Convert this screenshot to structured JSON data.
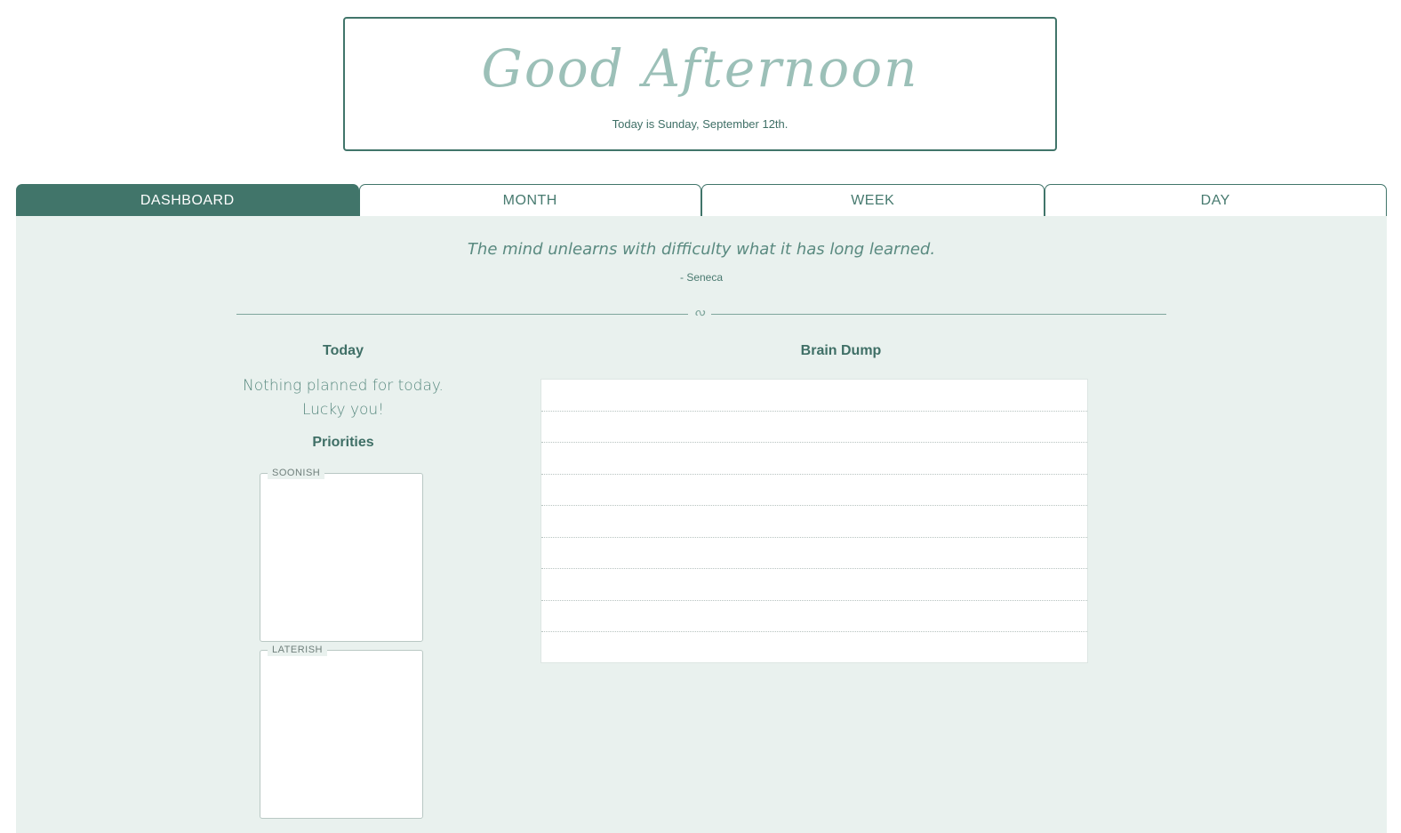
{
  "header": {
    "greeting": "Good Afternoon",
    "date_text": "Today is Sunday, September 12th."
  },
  "tabs": [
    {
      "label": "DASHBOARD",
      "active": true
    },
    {
      "label": "MONTH",
      "active": false
    },
    {
      "label": "WEEK",
      "active": false
    },
    {
      "label": "DAY",
      "active": false
    }
  ],
  "quote": {
    "text": "The mind unlearns with difficulty what it has long learned.",
    "author": "- Seneca"
  },
  "today": {
    "heading": "Today",
    "empty_line1": "Nothing planned for today.",
    "empty_line2": "Lucky you!"
  },
  "priorities": {
    "heading": "Priorities",
    "soonish_label": "SOONISH",
    "laterish_label": "LATERISH"
  },
  "brain_dump": {
    "heading": "Brain Dump",
    "rows": 9
  },
  "colors": {
    "accent": "#41756a",
    "panel_bg": "#e9f1ee",
    "greeting_text": "#9cc0b8"
  }
}
